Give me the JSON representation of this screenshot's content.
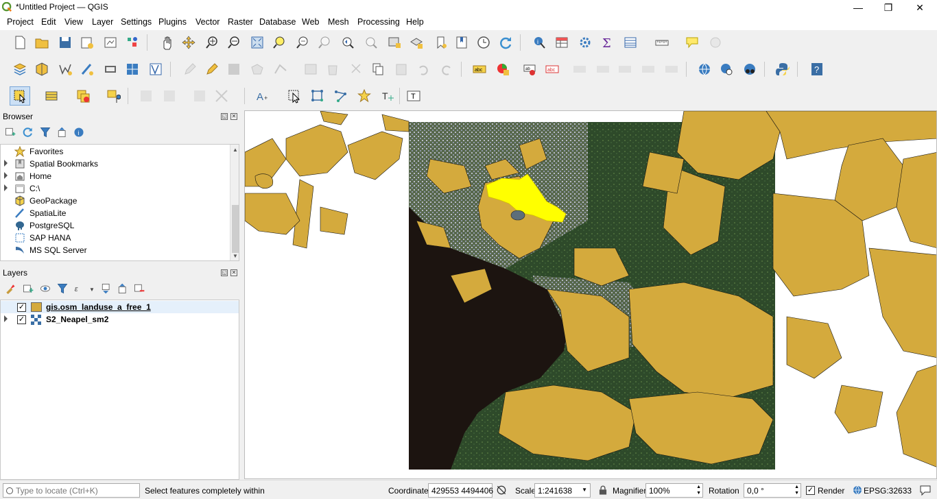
{
  "window": {
    "title": "*Untitled Project — QGIS",
    "minimize_glyph": "—",
    "restore_glyph": "❐",
    "close_glyph": "✕"
  },
  "menubar": {
    "items": [
      "Project",
      "Edit",
      "View",
      "Layer",
      "Settings",
      "Plugins",
      "Vector",
      "Raster",
      "Database",
      "Web",
      "Mesh",
      "Processing",
      "Help"
    ]
  },
  "browser": {
    "title": "Browser",
    "items": [
      {
        "label": "Favorites",
        "icon": "star-icon",
        "expandable": false
      },
      {
        "label": "Spatial Bookmarks",
        "icon": "bookmark-icon",
        "expandable": true
      },
      {
        "label": "Home",
        "icon": "home-folder-icon",
        "expandable": true
      },
      {
        "label": "C:\\",
        "icon": "drive-icon",
        "expandable": true
      },
      {
        "label": "GeoPackage",
        "icon": "geopackage-icon",
        "expandable": false
      },
      {
        "label": "SpatiaLite",
        "icon": "spatialite-icon",
        "expandable": false
      },
      {
        "label": "PostgreSQL",
        "icon": "postgresql-icon",
        "expandable": false
      },
      {
        "label": "SAP HANA",
        "icon": "sap-hana-icon",
        "expandable": false
      },
      {
        "label": "MS SQL Server",
        "icon": "mssql-icon",
        "expandable": false
      }
    ]
  },
  "layers": {
    "title": "Layers",
    "items": [
      {
        "label": "gis.osm_landuse_a_free_1",
        "checked": true,
        "active": true,
        "color": "#d4aa3d"
      },
      {
        "label": "S2_Neapel_sm2",
        "checked": true,
        "active": false,
        "expandable": true
      }
    ]
  },
  "statusbar": {
    "locator_placeholder": "Type to locate (Ctrl+K)",
    "message": "Select features completely within",
    "coordinate_label": "Coordinate",
    "coordinate_value": "429553 4494406",
    "scale_label": "Scale",
    "scale_value": "1:241638",
    "magnifier_label": "Magnifier",
    "magnifier_value": "100%",
    "rotation_label": "Rotation",
    "rotation_value": "0,0 °",
    "render_label": "Render",
    "render_checked": true,
    "crs": "EPSG:32633"
  },
  "colors": {
    "landuse_fill": "#d4aa3d",
    "selected_fill": "#ffff00",
    "sea": "#1c1410"
  }
}
